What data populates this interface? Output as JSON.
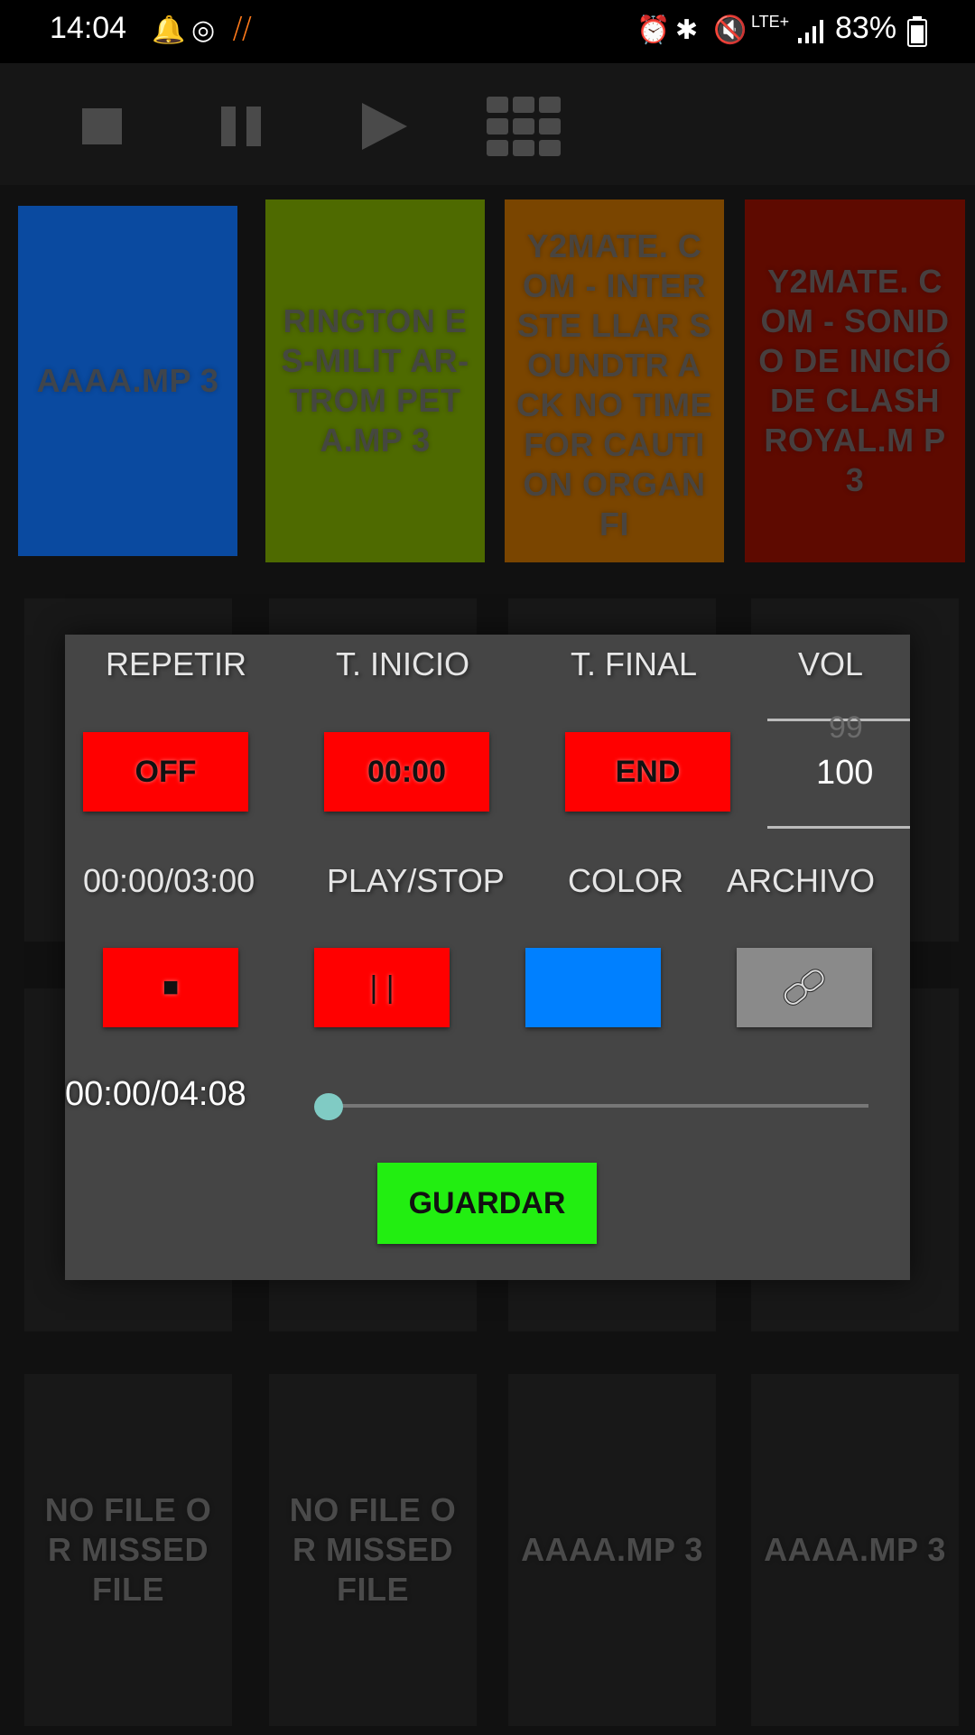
{
  "status_bar": {
    "time": "14:04",
    "battery": "83%",
    "network": "LTE+"
  },
  "toolbar": {
    "stop_icon": "stop-icon",
    "pause_icon": "pause-icon",
    "play_icon": "play-icon",
    "grid_icon": "grid-icon"
  },
  "tiles_top": [
    {
      "label": "AAAA.MP 3",
      "color": "#0a4aa0"
    },
    {
      "label": "RINGTON ES-MILIT AR-TROM PETA.MP 3",
      "color": "#4e6a00"
    },
    {
      "label": "Y2MATE. COM - INTERSTE LLAR SOUNDTR ACK NO TIME FOR CAUTION ORGANFI",
      "color": "#7a4500"
    },
    {
      "label": "Y2MATE. COM - SONIDO DE INICIÓ DE CLASH ROYAL.M P3",
      "color": "#5e0a00"
    }
  ],
  "tiles_bottom": [
    {
      "label": "NO FILE OR MISSED FILE"
    },
    {
      "label": "NO FILE OR MISSED FILE"
    },
    {
      "label": "AAAA.MP 3"
    },
    {
      "label": "AAAA.MP 3"
    }
  ],
  "dialog": {
    "headers": [
      "REPETIR",
      "T. INICIO",
      "T. FINAL",
      "VOL"
    ],
    "repeat_value": "OFF",
    "start_value": "00:00",
    "end_value": "END",
    "vol_prev": "99",
    "vol_current": "100",
    "labels2": [
      "00:00/03:00",
      "PLAY/STOP",
      "COLOR",
      "ARCHIVO"
    ],
    "stop_glyph": "■",
    "pause_glyph": "| |",
    "color_swatch": "#0080ff",
    "link_icon": "link-icon",
    "progress_time": "00:00/04:08",
    "progress_fraction": 0,
    "save_label": "GUARDAR"
  }
}
